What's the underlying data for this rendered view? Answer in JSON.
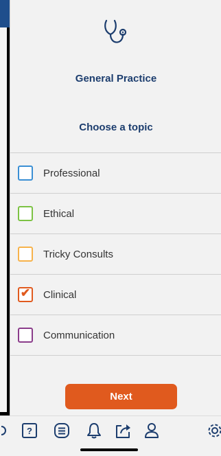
{
  "header": {
    "app_name": "General Practice",
    "logo_icon": "stethoscope-icon"
  },
  "main": {
    "subtitle": "Choose a topic",
    "topics": [
      {
        "label": "Professional",
        "color": "#3a8fd4",
        "checked": false
      },
      {
        "label": "Ethical",
        "color": "#7cc243",
        "checked": false
      },
      {
        "label": "Tricky Consults",
        "color": "#f7b24a",
        "checked": false
      },
      {
        "label": "Clinical",
        "color": "#e05a1e",
        "checked": true
      },
      {
        "label": "Communication",
        "color": "#8a3c8a",
        "checked": false
      }
    ],
    "next_label": "Next",
    "next_color": "#e05a1e"
  },
  "colors": {
    "title": "#1c3d6e",
    "accent": "#e05a1e",
    "icon": "#1c3d6e"
  },
  "bottom_nav": {
    "items": [
      "question-icon",
      "list-icon",
      "bell-icon",
      "share-icon",
      "user-icon",
      "settings-icon"
    ]
  }
}
